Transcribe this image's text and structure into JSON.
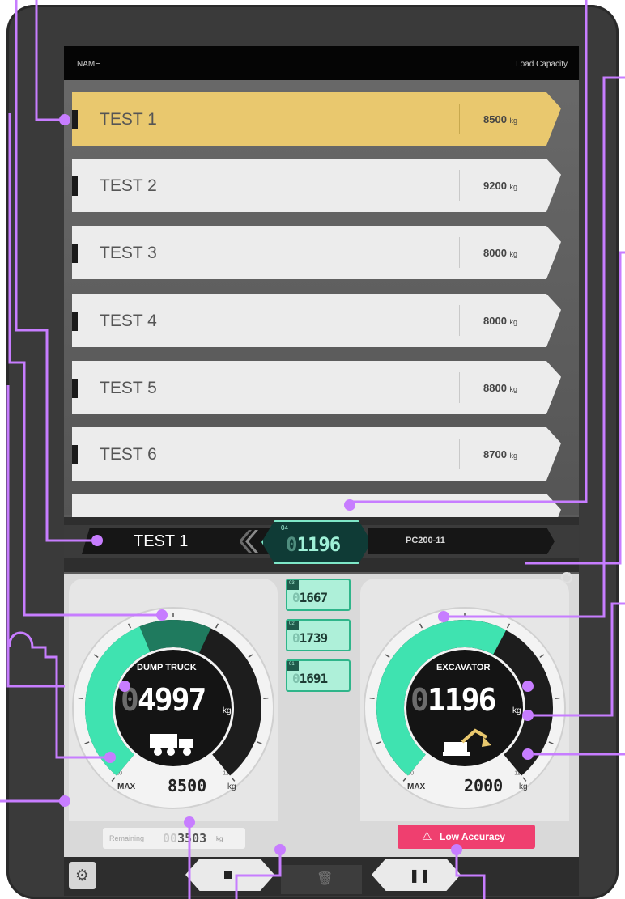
{
  "list": {
    "header_name": "NAME",
    "header_capacity": "Load Capacity",
    "unit": "kg",
    "rows": [
      {
        "name": "TEST 1",
        "capacity": "8500",
        "selected": true
      },
      {
        "name": "TEST 2",
        "capacity": "9200",
        "selected": false
      },
      {
        "name": "TEST 3",
        "capacity": "8000",
        "selected": false
      },
      {
        "name": "TEST 4",
        "capacity": "8000",
        "selected": false
      },
      {
        "name": "TEST 5",
        "capacity": "8800",
        "selected": false
      },
      {
        "name": "TEST 6",
        "capacity": "8700",
        "selected": false
      }
    ]
  },
  "status_bar": {
    "selected_truck": "TEST 1",
    "current_index": "04",
    "current_value_ghost": "0",
    "current_value": "1196",
    "excavator_model": "PC200-11"
  },
  "history": [
    {
      "index": "03",
      "ghost": "0",
      "value": "1667"
    },
    {
      "index": "02",
      "ghost": "0",
      "value": "1739"
    },
    {
      "index": "01",
      "ghost": "0",
      "value": "1691"
    }
  ],
  "dump_truck": {
    "label": "DUMP TRUCK",
    "value_ghost": "0",
    "value": "4997",
    "unit": "kg",
    "max_label": "MAX",
    "max_value": "8500",
    "max_unit": "kg",
    "fill_fraction": 0.59,
    "scale_ticks": [
      "10",
      "20",
      "30",
      "40",
      "50",
      "60",
      "70",
      "80",
      "90",
      "100",
      "110"
    ]
  },
  "remaining": {
    "label": "Remaining",
    "ghost": "00",
    "value": "3503",
    "unit": "kg"
  },
  "excavator": {
    "label": "EXCAVATOR",
    "value_ghost": "0",
    "value": "1196",
    "unit": "kg",
    "max_label": "MAX",
    "max_value": "2000",
    "max_unit": "kg",
    "fill_fraction": 0.6,
    "scale_ticks": [
      "10",
      "20",
      "30",
      "40",
      "50",
      "60",
      "70",
      "80",
      "90",
      "100",
      "110"
    ]
  },
  "warning": {
    "icon": "warning-icon",
    "text": "Low Accuracy"
  },
  "colors": {
    "accent_green": "#3fe3b0",
    "dark_green": "#1f7a5e",
    "selected_row": "#e9c86e",
    "warning": "#ef3f6f",
    "callout_purple": "#c77dff"
  },
  "icons": {
    "settings": "gear-icon",
    "stop": "stop-icon",
    "trash": "trash-icon",
    "pause": "pause-icon",
    "refresh": "refresh-icon"
  }
}
